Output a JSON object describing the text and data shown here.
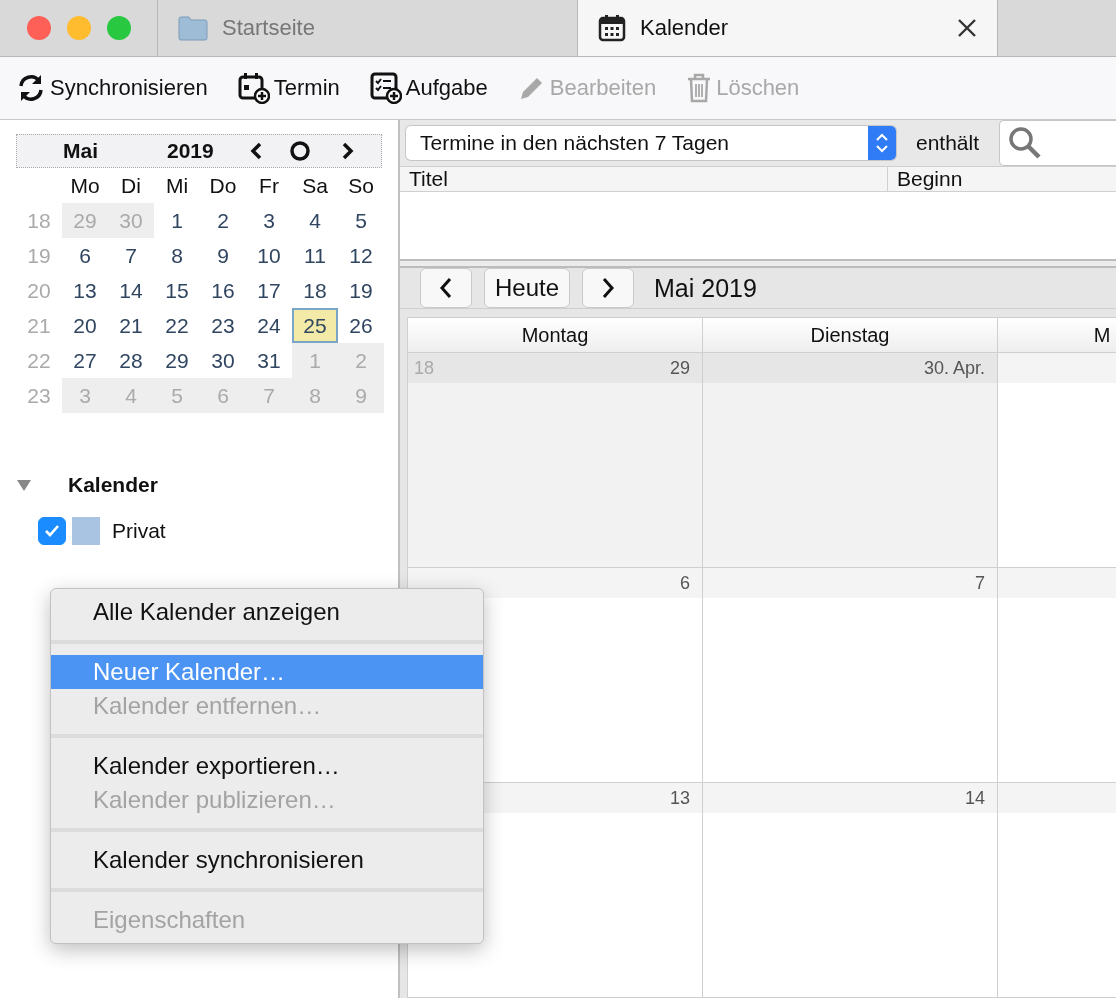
{
  "tabs": [
    {
      "label": "Startseite",
      "kind": "folder",
      "selected": false
    },
    {
      "label": "Kalender",
      "kind": "calendar",
      "selected": true
    }
  ],
  "toolbar": [
    {
      "label": "Synchronisieren",
      "kind": "sync",
      "disabled": false
    },
    {
      "label": "Termin",
      "kind": "event",
      "disabled": false
    },
    {
      "label": "Aufgabe",
      "kind": "task",
      "disabled": false
    },
    {
      "label": "Bearbeiten",
      "kind": "edit",
      "disabled": true
    },
    {
      "label": "Löschen",
      "kind": "delete",
      "disabled": true
    }
  ],
  "mini_calendar": {
    "month": "Mai",
    "year": "2019",
    "weekdays": [
      "Mo",
      "Di",
      "Mi",
      "Do",
      "Fr",
      "Sa",
      "So"
    ],
    "weeks": [
      {
        "week": "18",
        "days": [
          {
            "label": "29",
            "outside": true,
            "selected": false
          },
          {
            "label": "30",
            "outside": true,
            "selected": false
          },
          {
            "label": "1",
            "outside": false,
            "selected": false
          },
          {
            "label": "2",
            "outside": false,
            "selected": false
          },
          {
            "label": "3",
            "outside": false,
            "selected": false
          },
          {
            "label": "4",
            "outside": false,
            "selected": false
          },
          {
            "label": "5",
            "outside": false,
            "selected": false
          }
        ]
      },
      {
        "week": "19",
        "days": [
          {
            "label": "6",
            "outside": false,
            "selected": false
          },
          {
            "label": "7",
            "outside": false,
            "selected": false
          },
          {
            "label": "8",
            "outside": false,
            "selected": false
          },
          {
            "label": "9",
            "outside": false,
            "selected": false
          },
          {
            "label": "10",
            "outside": false,
            "selected": false
          },
          {
            "label": "11",
            "outside": false,
            "selected": false
          },
          {
            "label": "12",
            "outside": false,
            "selected": false
          }
        ]
      },
      {
        "week": "20",
        "days": [
          {
            "label": "13",
            "outside": false,
            "selected": false
          },
          {
            "label": "14",
            "outside": false,
            "selected": false
          },
          {
            "label": "15",
            "outside": false,
            "selected": false
          },
          {
            "label": "16",
            "outside": false,
            "selected": false
          },
          {
            "label": "17",
            "outside": false,
            "selected": false
          },
          {
            "label": "18",
            "outside": false,
            "selected": false
          },
          {
            "label": "19",
            "outside": false,
            "selected": false
          }
        ]
      },
      {
        "week": "21",
        "days": [
          {
            "label": "20",
            "outside": false,
            "selected": false
          },
          {
            "label": "21",
            "outside": false,
            "selected": false
          },
          {
            "label": "22",
            "outside": false,
            "selected": false
          },
          {
            "label": "23",
            "outside": false,
            "selected": false
          },
          {
            "label": "24",
            "outside": false,
            "selected": false
          },
          {
            "label": "25",
            "outside": false,
            "selected": true
          },
          {
            "label": "26",
            "outside": false,
            "selected": false
          }
        ]
      },
      {
        "week": "22",
        "days": [
          {
            "label": "27",
            "outside": false,
            "selected": false
          },
          {
            "label": "28",
            "outside": false,
            "selected": false
          },
          {
            "label": "29",
            "outside": false,
            "selected": false
          },
          {
            "label": "30",
            "outside": false,
            "selected": false
          },
          {
            "label": "31",
            "outside": false,
            "selected": false
          },
          {
            "label": "1",
            "outside": true,
            "selected": false
          },
          {
            "label": "2",
            "outside": true,
            "selected": false
          }
        ]
      },
      {
        "week": "23",
        "days": [
          {
            "label": "3",
            "outside": true,
            "selected": false
          },
          {
            "label": "4",
            "outside": true,
            "selected": false
          },
          {
            "label": "5",
            "outside": true,
            "selected": false
          },
          {
            "label": "6",
            "outside": true,
            "selected": false
          },
          {
            "label": "7",
            "outside": true,
            "selected": false
          },
          {
            "label": "8",
            "outside": true,
            "selected": false
          },
          {
            "label": "9",
            "outside": true,
            "selected": false
          }
        ]
      }
    ]
  },
  "calendars": {
    "title": "Kalender",
    "expanded": true,
    "items": [
      {
        "name": "Privat",
        "checked": true,
        "color": "#a9c4e2"
      }
    ]
  },
  "filter": {
    "value": "Termine in den nächsten 7 Tagen",
    "label": "enthält"
  },
  "list": {
    "columns": [
      "Titel",
      "Beginn"
    ]
  },
  "month_view": {
    "title": "Mai 2019",
    "today_button": "Heute",
    "columns": [
      "Montag",
      "Dienstag",
      "M"
    ],
    "weeks": [
      {
        "week": "18",
        "days": [
          {
            "label": "29",
            "outside": true
          },
          {
            "label": "30. Apr.",
            "outside": true
          },
          {
            "outside": false
          }
        ]
      },
      {
        "days": [
          {
            "label": "6",
            "outside": false
          },
          {
            "label": "7",
            "outside": false
          },
          {
            "outside": false
          }
        ]
      },
      {
        "days": [
          {
            "label": "13",
            "outside": false
          },
          {
            "label": "14",
            "outside": false
          },
          {
            "outside": false
          }
        ]
      }
    ]
  },
  "context_menu": [
    [
      {
        "label": "Alle Kalender anzeigen",
        "disabled": false,
        "selected": false
      }
    ],
    [
      {
        "label": "Neuer Kalender…",
        "disabled": false,
        "selected": true
      },
      {
        "label": "Kalender entfernen…",
        "disabled": true,
        "selected": false
      }
    ],
    [
      {
        "label": "Kalender exportieren…",
        "disabled": false,
        "selected": false
      },
      {
        "label": "Kalender publizieren…",
        "disabled": true,
        "selected": false
      }
    ],
    [
      {
        "label": "Kalender synchronisieren",
        "disabled": false,
        "selected": false
      }
    ],
    [
      {
        "label": "Eigenschaften",
        "disabled": true,
        "selected": false
      }
    ]
  ]
}
